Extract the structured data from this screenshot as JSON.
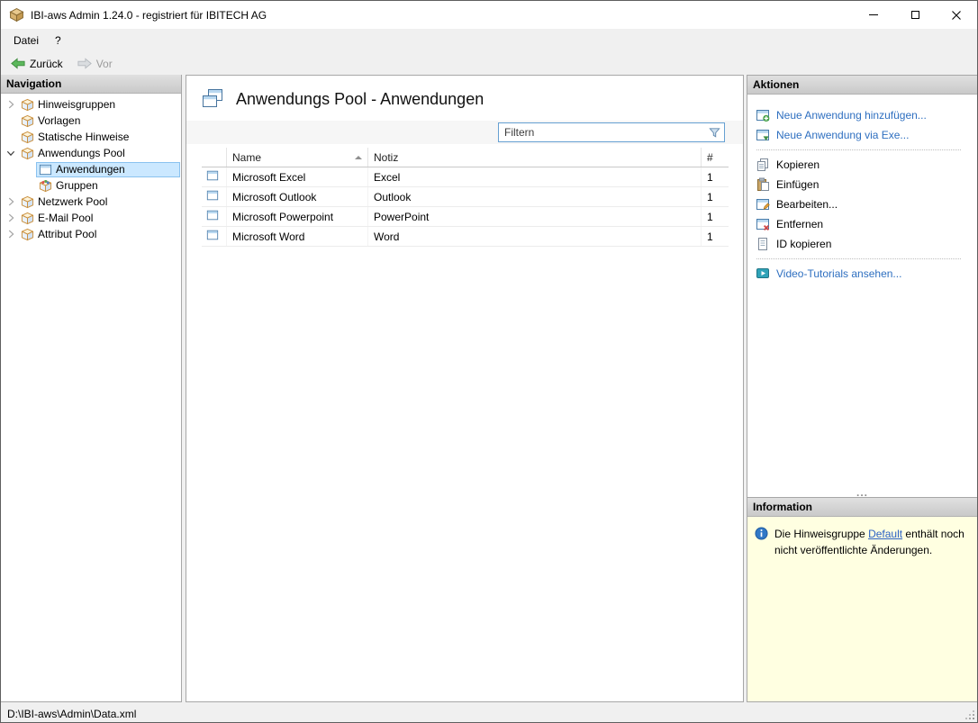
{
  "window": {
    "title": "IBI-aws Admin 1.24.0 - registriert für IBITECH AG",
    "icon": "app-cube-icon"
  },
  "menu": {
    "items": [
      "Datei",
      "?"
    ]
  },
  "toolbar": {
    "back_label": "Zurück",
    "back_icon": "back-arrow-icon",
    "forward_label": "Vor",
    "forward_icon": "forward-arrow-icon"
  },
  "navigation": {
    "header": "Navigation",
    "items": [
      {
        "label": "Hinweisgruppen",
        "icon": "box-icon",
        "state": "collapsed",
        "level": 0,
        "selected": false
      },
      {
        "label": "Vorlagen",
        "icon": "box-icon",
        "state": "leaf",
        "level": 0,
        "selected": false
      },
      {
        "label": "Statische Hinweise",
        "icon": "box-icon",
        "state": "leaf",
        "level": 0,
        "selected": false
      },
      {
        "label": "Anwendungs Pool",
        "icon": "box-icon",
        "state": "expanded",
        "level": 0,
        "selected": false
      },
      {
        "label": "Anwendungen",
        "icon": "window-icon",
        "state": "leaf",
        "level": 1,
        "selected": true
      },
      {
        "label": "Gruppen",
        "icon": "box-group-icon",
        "state": "leaf",
        "level": 1,
        "selected": false
      },
      {
        "label": "Netzwerk Pool",
        "icon": "box-icon",
        "state": "collapsed",
        "level": 0,
        "selected": false
      },
      {
        "label": "E-Mail Pool",
        "icon": "box-icon",
        "state": "collapsed",
        "level": 0,
        "selected": false
      },
      {
        "label": "Attribut Pool",
        "icon": "box-icon",
        "state": "collapsed",
        "level": 0,
        "selected": false
      }
    ]
  },
  "main": {
    "title": "Anwendungs Pool - Anwendungen",
    "title_icon": "windows-stack-icon",
    "filter": {
      "placeholder": "Filtern",
      "icon": "funnel-icon"
    },
    "table": {
      "columns": {
        "name": "Name",
        "notiz": "Notiz",
        "count": "#"
      },
      "sort": {
        "column": "Name",
        "direction": "ascending",
        "icon": "sort-ascending-icon"
      },
      "rows": [
        {
          "icon": "window-icon",
          "name": "Microsoft Excel",
          "notiz": "Excel",
          "count": "1"
        },
        {
          "icon": "window-icon",
          "name": "Microsoft Outlook",
          "notiz": "Outlook",
          "count": "1"
        },
        {
          "icon": "window-icon",
          "name": "Microsoft Powerpoint",
          "notiz": "PowerPoint",
          "count": "1"
        },
        {
          "icon": "window-icon",
          "name": "Microsoft Word",
          "notiz": "Word",
          "count": "1"
        }
      ]
    }
  },
  "actions": {
    "header": "Aktionen",
    "items": [
      {
        "label": "Neue Anwendung hinzufügen...",
        "type": "link",
        "icon": "window-add-icon"
      },
      {
        "label": "Neue Anwendung via Exe...",
        "type": "link",
        "icon": "window-exe-icon"
      },
      {
        "label": "Kopieren",
        "type": "normal",
        "icon": "copy-icon"
      },
      {
        "label": "Einfügen",
        "type": "normal",
        "icon": "paste-icon"
      },
      {
        "label": "Bearbeiten...",
        "type": "normal",
        "icon": "edit-icon"
      },
      {
        "label": "Entfernen",
        "type": "normal",
        "icon": "remove-icon"
      },
      {
        "label": "ID kopieren",
        "type": "normal",
        "icon": "id-copy-icon"
      },
      {
        "label": "Video-Tutorials ansehen...",
        "type": "link",
        "icon": "video-icon"
      }
    ],
    "resize_grip": "..."
  },
  "information": {
    "header": "Information",
    "icon": "info-icon",
    "message": {
      "before": "Die Hinweisgruppe ",
      "link": "Default",
      "after": " enthält noch nicht veröffentlichte Änderungen."
    }
  },
  "statusbar": {
    "path": "D:\\IBI-aws\\Admin\\Data.xml"
  },
  "colors": {
    "link_blue": "#2e6fc0",
    "selection_bg": "#cbe8ff",
    "selection_border": "#8ac2ef",
    "panel_header_bg": "#d5d5d5",
    "info_bg": "#ffffe1",
    "back_arrow_green": "#5cb85c",
    "window_bg": "#f0f0f0"
  }
}
